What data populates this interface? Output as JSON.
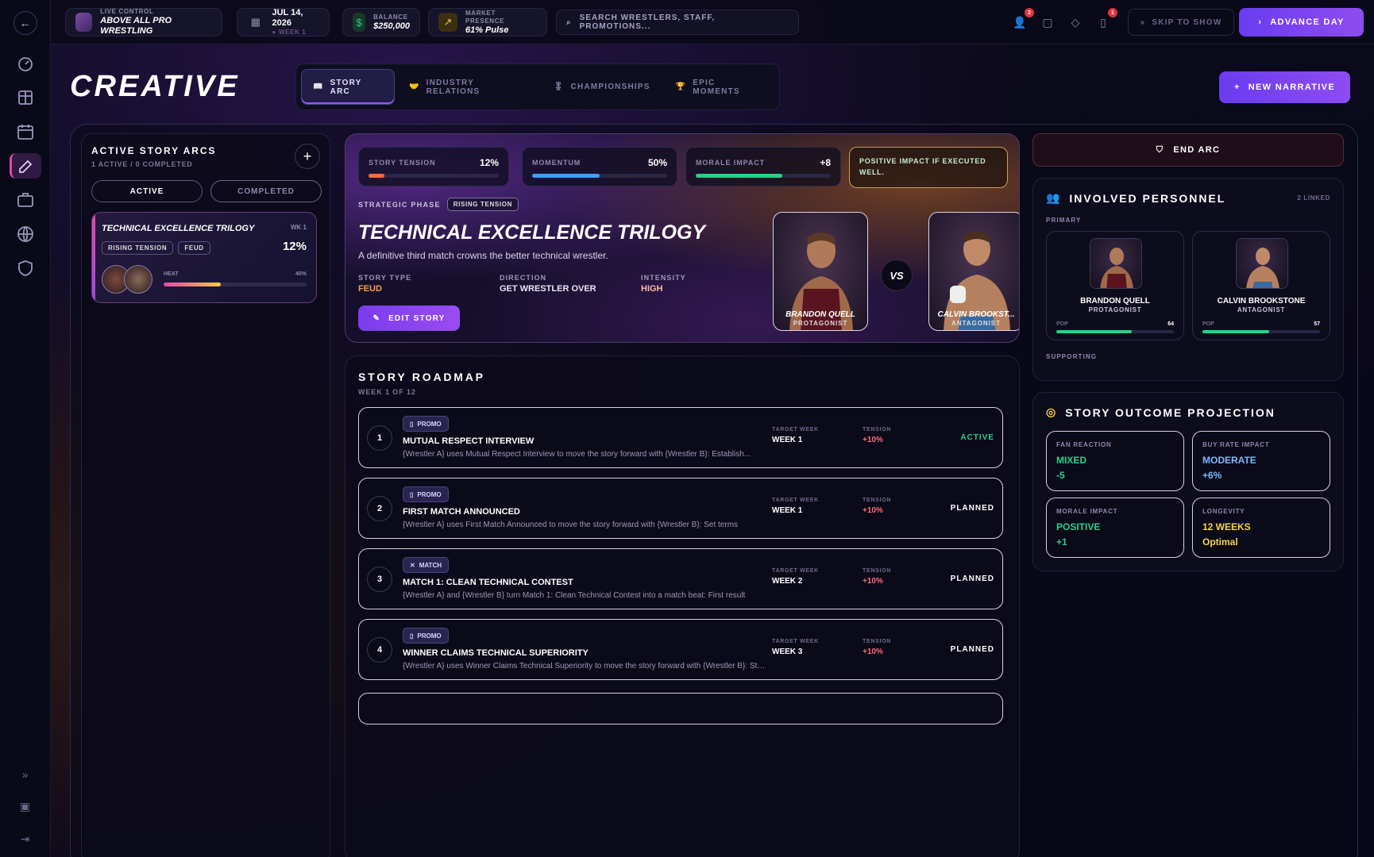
{
  "topbar": {
    "control_label": "LIVE CONTROL",
    "promotion_name": "ABOVE ALL PRO WRESTLING",
    "date": "JUL 14, 2026",
    "week": "● WEEK 1",
    "balance_label": "BALANCE",
    "balance": "$250,000",
    "presence_label": "MARKET PRESENCE",
    "presence": "61% Pulse",
    "search_placeholder": "SEARCH WRESTLERS, STAFF, PROMOTIONS...",
    "notif_staff": "2",
    "notif_inbox": "1",
    "skip_label": "SKIP TO SHOW",
    "advance_label": "ADVANCE DAY"
  },
  "page": {
    "title": "CREATIVE",
    "tabs": [
      {
        "label": "STORY ARC",
        "icon": "book-icon"
      },
      {
        "label": "INDUSTRY RELATIONS",
        "icon": "handshake-icon"
      },
      {
        "label": "CHAMPIONSHIPS",
        "icon": "medal-icon"
      },
      {
        "label": "EPIC MOMENTS",
        "icon": "trophy-icon"
      }
    ],
    "new_narrative": "NEW NARRATIVE"
  },
  "arcs": {
    "title": "ACTIVE STORY ARCS",
    "subtitle": "1 ACTIVE / 0 COMPLETED",
    "seg_active": "ACTIVE",
    "seg_completed": "COMPLETED",
    "card": {
      "title": "TECHNICAL EXCELLENCE TRILOGY",
      "week": "WK 1",
      "badge_phase": "RISING TENSION",
      "badge_type": "FEUD",
      "tension": "12%",
      "heat_label": "HEAT",
      "heat_value": "40%",
      "heat_fraction": 0.4
    }
  },
  "hero": {
    "stats": [
      {
        "label": "STORY TENSION",
        "value": "12%",
        "fraction": 0.12,
        "color": "#ff6a3a"
      },
      {
        "label": "MOMENTUM",
        "value": "50%",
        "fraction": 0.5,
        "color": "#3aa0ff"
      },
      {
        "label": "MORALE IMPACT",
        "value": "+8",
        "fraction": 0.64,
        "color": "#27d18a"
      }
    ],
    "note": "POSITIVE IMPACT IF EXECUTED WELL.",
    "phase_label": "STRATEGIC PHASE",
    "phase_value": "RISING TENSION",
    "title": "TECHNICAL EXCELLENCE TRILOGY",
    "description": "A definitive third match crowns the better technical wrestler.",
    "story_type_label": "STORY TYPE",
    "story_type": "FEUD",
    "direction_label": "DIRECTION",
    "direction": "GET WRESTLER OVER",
    "intensity_label": "INTENSITY",
    "intensity": "HIGH",
    "edit_label": "EDIT STORY",
    "protagonist_name": "BRANDON QUELL",
    "protagonist_role": "PROTAGONIST",
    "antagonist_name": "CALVIN BROOKST...",
    "antagonist_role": "ANTAGONIST",
    "vs": "VS"
  },
  "roadmap": {
    "title": "STORY ROADMAP",
    "subtitle": "WEEK 1 OF 12",
    "target_label": "TARGET WEEK",
    "tension_label": "TENSION",
    "beats": [
      {
        "num": "1",
        "type": "PROMO",
        "title": "MUTUAL RESPECT INTERVIEW",
        "desc": "{Wrestler A} uses Mutual Respect Interview to move the story forward with {Wrestler B}: Establish...",
        "week": "WEEK 1",
        "tension": "+10%",
        "status": "ACTIVE"
      },
      {
        "num": "2",
        "type": "PROMO",
        "title": "FIRST MATCH ANNOUNCED",
        "desc": "{Wrestler A} uses First Match Announced to move the story forward with {Wrestler B}: Set terms",
        "week": "WEEK 1",
        "tension": "+10%",
        "status": "PLANNED"
      },
      {
        "num": "3",
        "type": "MATCH",
        "title": "MATCH 1: CLEAN TECHNICAL CONTEST",
        "desc": "{Wrestler A} and {Wrestler B} turn Match 1: Clean Technical Contest into a match beat: First result",
        "week": "WEEK 2",
        "tension": "+10%",
        "status": "PLANNED"
      },
      {
        "num": "4",
        "type": "PROMO",
        "title": "WINNER CLAIMS TECHNICAL SUPERIORITY",
        "desc": "{Wrestler A} uses Winner Claims Technical Superiority to move the story forward with {Wrestler B}: Sta...",
        "week": "WEEK 3",
        "tension": "+10%",
        "status": "PLANNED"
      }
    ]
  },
  "personnel": {
    "end_arc": "END ARC",
    "title": "INVOLVED PERSONNEL",
    "linked": "2 LINKED",
    "primary_label": "PRIMARY",
    "supporting_label": "SUPPORTING",
    "people": [
      {
        "name": "BRANDON QUELL",
        "role": "PROTAGONIST",
        "pop_label": "POP",
        "pop": "64",
        "fraction": 0.64
      },
      {
        "name": "CALVIN BROOKSTONE",
        "role": "ANTAGONIST",
        "pop_label": "POP",
        "pop": "57",
        "fraction": 0.57
      }
    ]
  },
  "outcome": {
    "title": "STORY OUTCOME PROJECTION",
    "cards": [
      {
        "label": "FAN REACTION",
        "value": "MIXED",
        "delta": "-5",
        "color": "#27d18a",
        "delta_color": "#27d18a"
      },
      {
        "label": "BUY RATE IMPACT",
        "value": "MODERATE",
        "delta": "+6%",
        "color": "#7ab8ff",
        "delta_color": "#7ab8ff"
      },
      {
        "label": "MORALE IMPACT",
        "value": "POSITIVE",
        "delta": "+1",
        "color": "#27d18a",
        "delta_color": "#27d18a"
      },
      {
        "label": "LONGEVITY",
        "value": "12 WEEKS",
        "delta": "Optimal",
        "color": "#f5d34a",
        "delta_color": "#f5d34a"
      }
    ]
  }
}
